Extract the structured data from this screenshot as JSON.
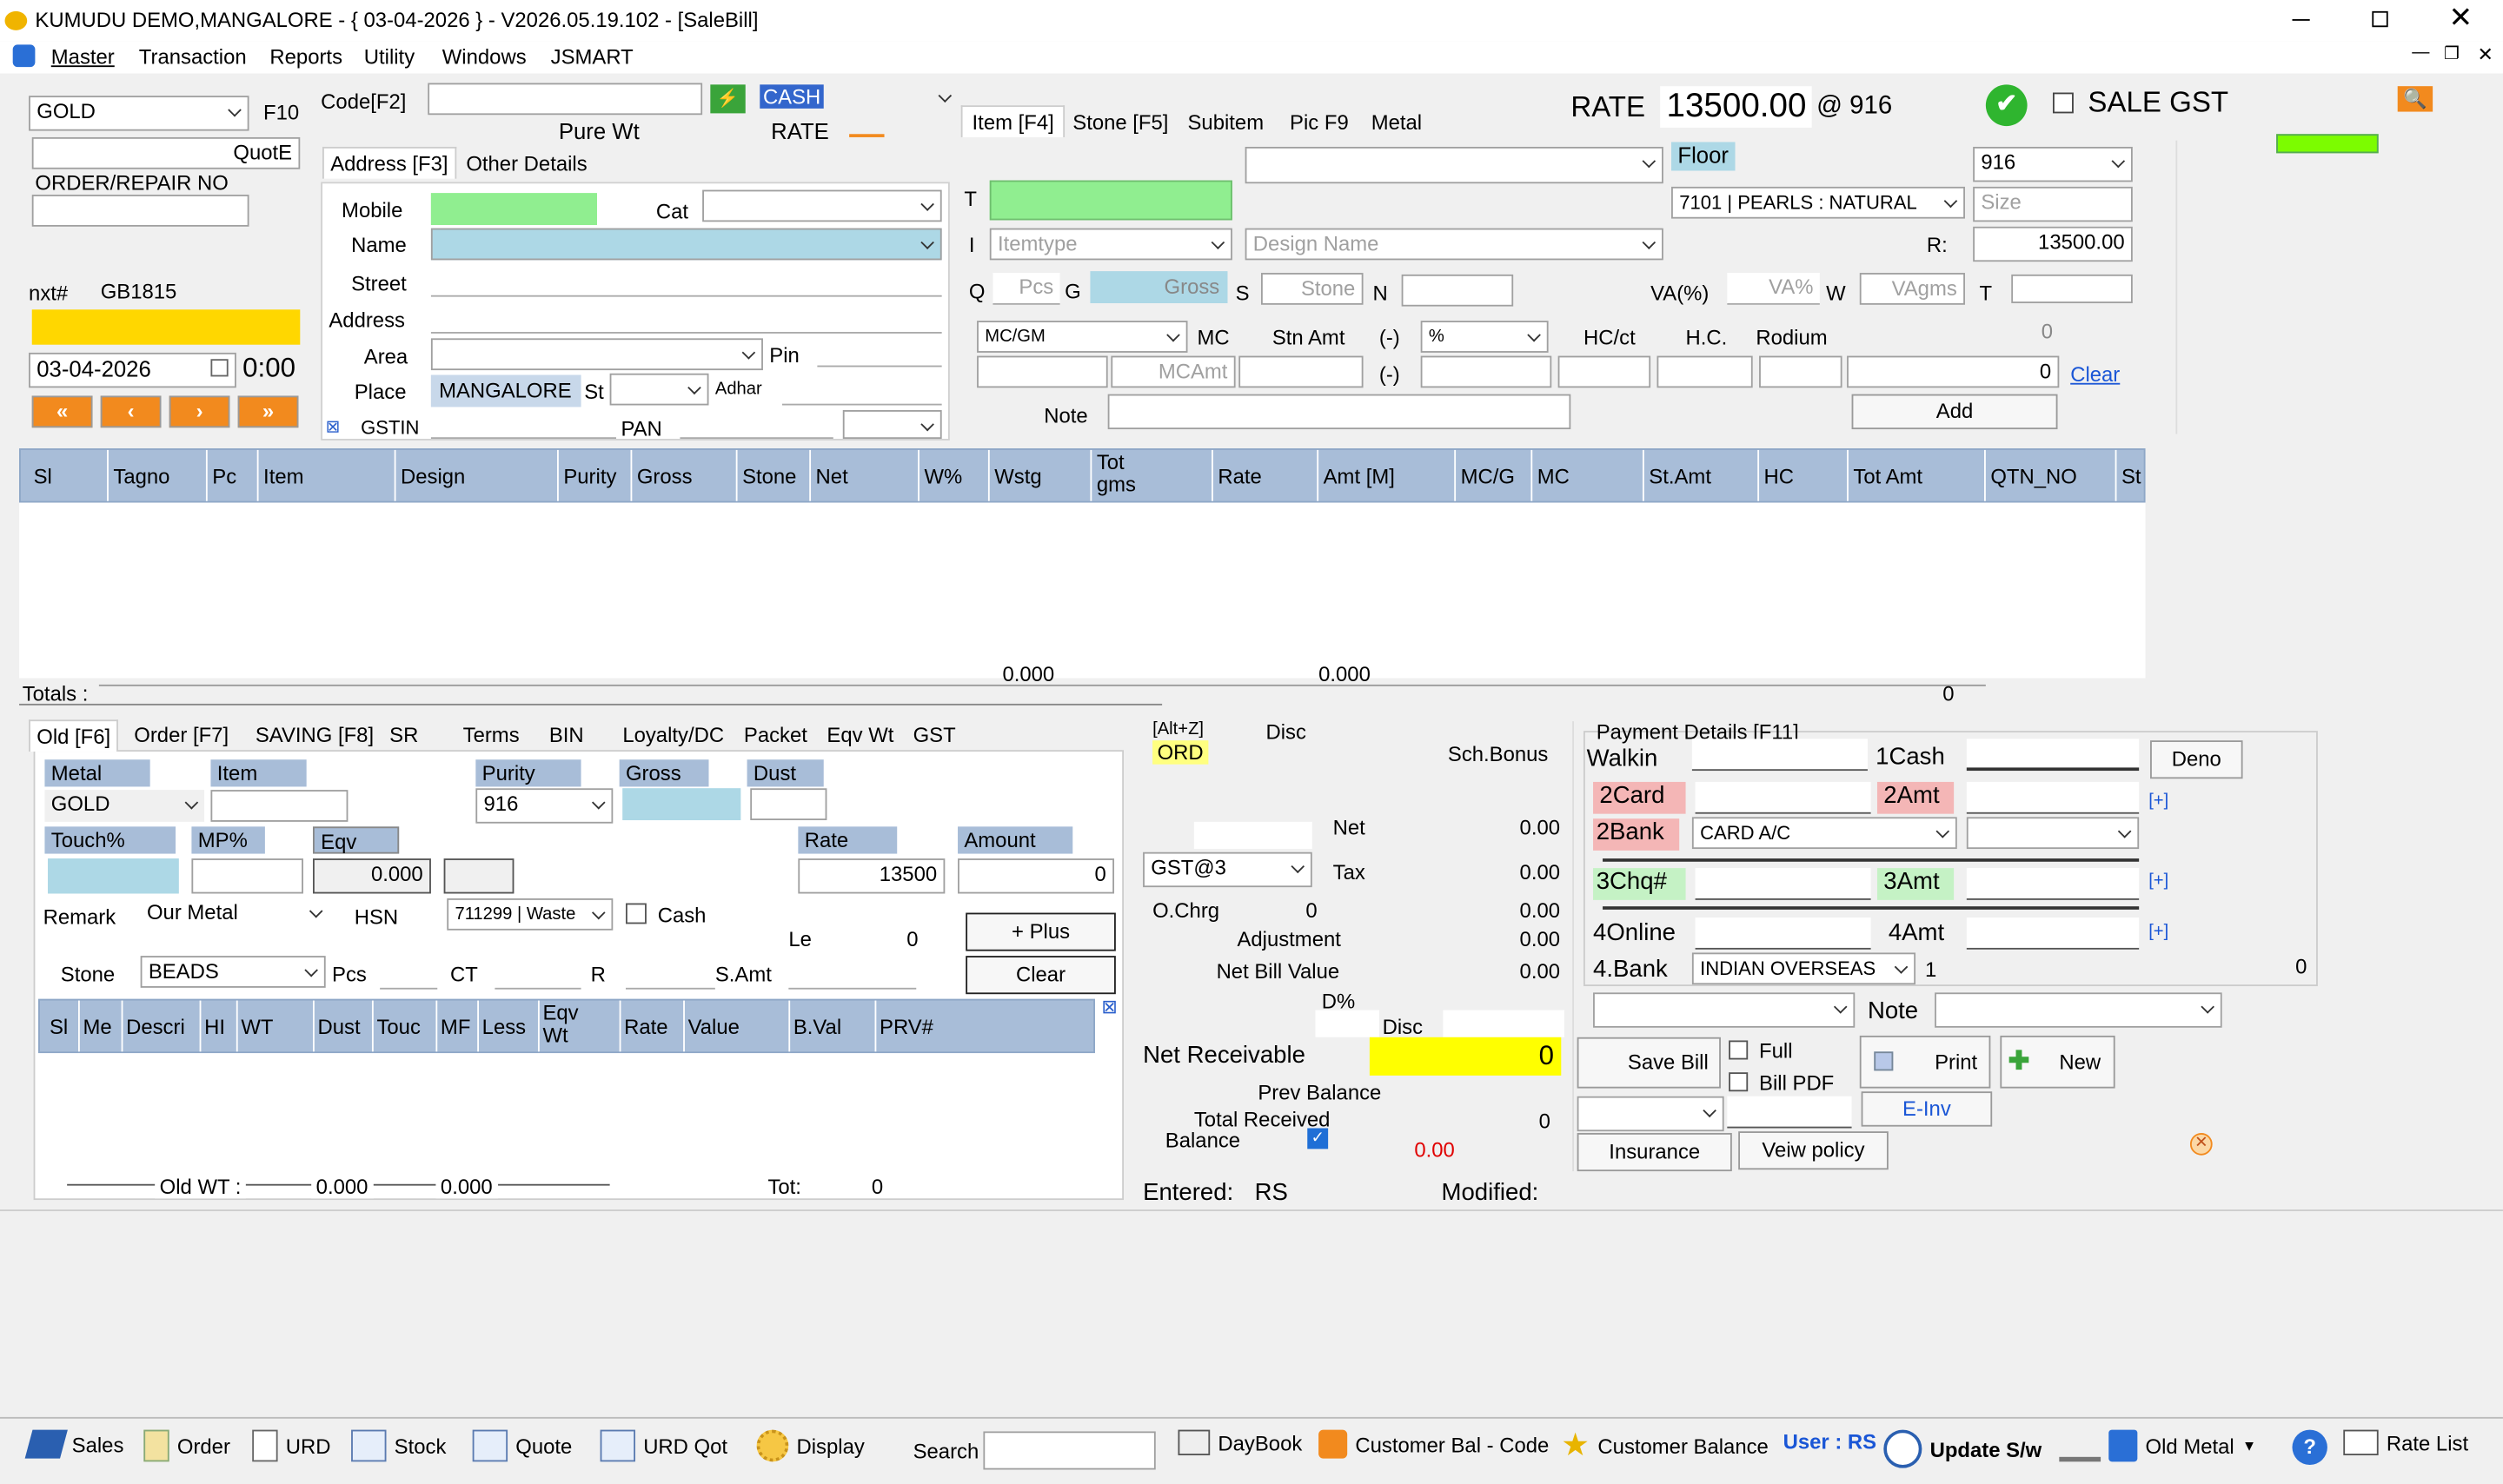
{
  "title": "KUMUDU DEMO,MANGALORE - { 03-04-2026 } - V2026.05.19.102 - [SaleBill]",
  "menu": [
    "Master",
    "Transaction",
    "Reports",
    "Utility",
    "Windows",
    "JSMART"
  ],
  "left": {
    "metal": "GOLD",
    "f10": "F10",
    "quote": "QuotE",
    "order_repair": "ORDER/REPAIR NO",
    "nxt_label": "nxt#",
    "nxt_value": "GB1815",
    "date": "03-04-2026",
    "time": "0:00",
    "nav": [
      "«",
      "‹",
      "›",
      "»"
    ]
  },
  "code": {
    "label": "Code[F2]",
    "pure_wt": "Pure Wt",
    "rate_label": "RATE",
    "payment_mode": "CASH"
  },
  "address_tabs": [
    "Address [F3]",
    "Other Details"
  ],
  "address": {
    "mobile": "Mobile",
    "cat": "Cat",
    "name": "Name",
    "street": "Street",
    "address": "Address",
    "area": "Area",
    "pin": "Pin",
    "place": "Place",
    "place_value": "MANGALORE",
    "st": "St",
    "adhar": "Adhar",
    "gstin": "GSTIN",
    "pan": "PAN"
  },
  "item_tabs": [
    "Item [F4]",
    "Stone [F5]",
    "Subitem",
    "Pic F9",
    "Metal"
  ],
  "rate_bar": {
    "label": "RATE",
    "value": "13500.00",
    "at": "@ 916",
    "sale_gst": "SALE GST"
  },
  "item": {
    "floor": "Floor",
    "purity": "916",
    "pearls": "7101 | PEARLS : NATURAL",
    "size_ph": "Size",
    "r_label": "R:",
    "r_value": "13500.00",
    "t": "T",
    "i": "I",
    "itemtype_ph": "Itemtype",
    "design_ph": "Design Name",
    "q": "Q",
    "pcs_ph": "Pcs",
    "g": "G",
    "gross_ph": "Gross",
    "s": "S",
    "stone_ph": "Stone",
    "n": "N",
    "va_label": "VA(%)",
    "va_ph": "VA%",
    "w": "W",
    "vagms_ph": "VAgms",
    "t2": "T",
    "mc_type": "MC/GM",
    "mc": "MC",
    "stn_amt": "Stn Amt",
    "minus": "(-)",
    "pct": "%",
    "hc_ct": "HC/ct",
    "hc": "H.C.",
    "rodium": "Rodium",
    "zero1": "0",
    "mcamt_ph": "MCAmt",
    "minus2": "(-)",
    "zero2": "0",
    "clear": "Clear",
    "note": "Note",
    "add": "Add"
  },
  "grid_headers": [
    "Sl",
    "Tagno",
    "Pc",
    "Item",
    "Design",
    "Purity",
    "Gross",
    "Stone",
    "Net",
    "W%",
    "Wstg",
    "Tot gms",
    "Rate",
    "Amt [M]",
    "MC/G",
    "MC",
    "St.Amt",
    "HC",
    "Tot Amt",
    "QTN_NO",
    "St"
  ],
  "totals": {
    "label": "Totals :",
    "v1": "0.000",
    "v2": "0.000",
    "v3": "0"
  },
  "old_tabs": [
    "Old [F6]",
    "Order [F7]",
    "SAVING [F8]",
    "SR",
    "Terms",
    "BIN",
    "Loyalty/DC",
    "Packet",
    "Eqv Wt",
    "GST"
  ],
  "old": {
    "metal_lbl": "Metal",
    "item_lbl": "Item",
    "purity_lbl": "Purity",
    "gross_lbl": "Gross",
    "dust_lbl": "Dust",
    "metal": "GOLD",
    "purity": "916",
    "touch_lbl": "Touch%",
    "mp_lbl": "MP%",
    "eqv_lbl": "Eqv WT",
    "eqv_val": "0.000",
    "rate_lbl": "Rate",
    "amount_lbl": "Amount",
    "rate": "13500",
    "amount": "0",
    "remark": "Remark",
    "remark_val": "Our Metal",
    "hsn": "HSN",
    "hsn_val": "711299 | Waste",
    "cash": "Cash",
    "le": "Le",
    "le_val": "0",
    "plus": "+ Plus",
    "stone": "Stone",
    "stone_val": "BEADS",
    "pcs": "Pcs",
    "ct": "CT",
    "r": "R",
    "samt": "S.Amt",
    "clear": "Clear",
    "grid": [
      "Sl",
      "Me",
      "Descri",
      "HI",
      "WT",
      "Dust",
      "Touc",
      "MF",
      "Less",
      "Eqv Wt",
      "Rate",
      "Value",
      "B.Val",
      "PRV#"
    ],
    "old_wt": "Old WT :",
    "wt1": "0.000",
    "wt2": "0.000",
    "tot": "Tot:",
    "tot_val": "0"
  },
  "summary": {
    "altz": "[Alt+Z]",
    "ord": "ORD",
    "disc": "Disc",
    "sch_bonus": "Sch.Bonus",
    "net": "Net",
    "net_v": "0.00",
    "gst": "GST@3",
    "tax": "Tax",
    "tax_v": "0.00",
    "ochrg": "O.Chrg",
    "ochrg_n": "0",
    "ochrg_v": "0.00",
    "adj": "Adjustment",
    "adj_v": "0.00",
    "nbv": "Net Bill Value",
    "nbv_v": "0.00",
    "dpct": "D%",
    "disc2": "Disc",
    "net_recv": "Net Receivable",
    "net_recv_v": "0",
    "prev_bal": "Prev Balance",
    "tot_recv": "Total Received",
    "tot_recv_v": "0",
    "balance": "Balance",
    "balance_v": "0.00",
    "entered": "Entered:",
    "entered_v": "RS",
    "modified": "Modified:"
  },
  "payment": {
    "title": "Payment Details [F11]",
    "walkin": "Walkin",
    "cash1": "1Cash",
    "deno": "Deno",
    "card2": "2Card",
    "amt2": "2Amt",
    "bank2": "2Bank",
    "card_ac": "CARD A/C",
    "chq3": "3Chq#",
    "amt3": "3Amt",
    "online4": "4Online",
    "amt4": "4Amt",
    "bank4": "4.Bank",
    "indian": "INDIAN OVERSEAS",
    "one": "1",
    "zero": "0",
    "note": "Note",
    "save": "Save Bill",
    "full": "Full",
    "bill_pdf": "Bill PDF",
    "print": "Print",
    "new": "New",
    "einv": "E-Inv",
    "insurance": "Insurance",
    "policy": "Veiw policy",
    "plus": "[+]"
  },
  "toolbar": {
    "sales": "Sales",
    "order": "Order",
    "urd": "URD",
    "stock": "Stock",
    "quote": "Quote",
    "urdqot": "URD Qot",
    "display": "Display",
    "search": "Search",
    "daybook": "DayBook",
    "custbal_code": "Customer Bal - Code",
    "custbal": "Customer Balance",
    "user": "User : RS",
    "update": "Update S/w",
    "oldmetal": "Old Metal",
    "ratelist": "Rate List"
  },
  "colors": {
    "accent_yellow": "#ffd700",
    "net_yellow": "#ffff00",
    "green": "#90ee90",
    "lightblue": "#add8e6",
    "header_blue": "#a8bdd8",
    "pink": "#f4b6b6",
    "mint": "#c5f2c5"
  }
}
